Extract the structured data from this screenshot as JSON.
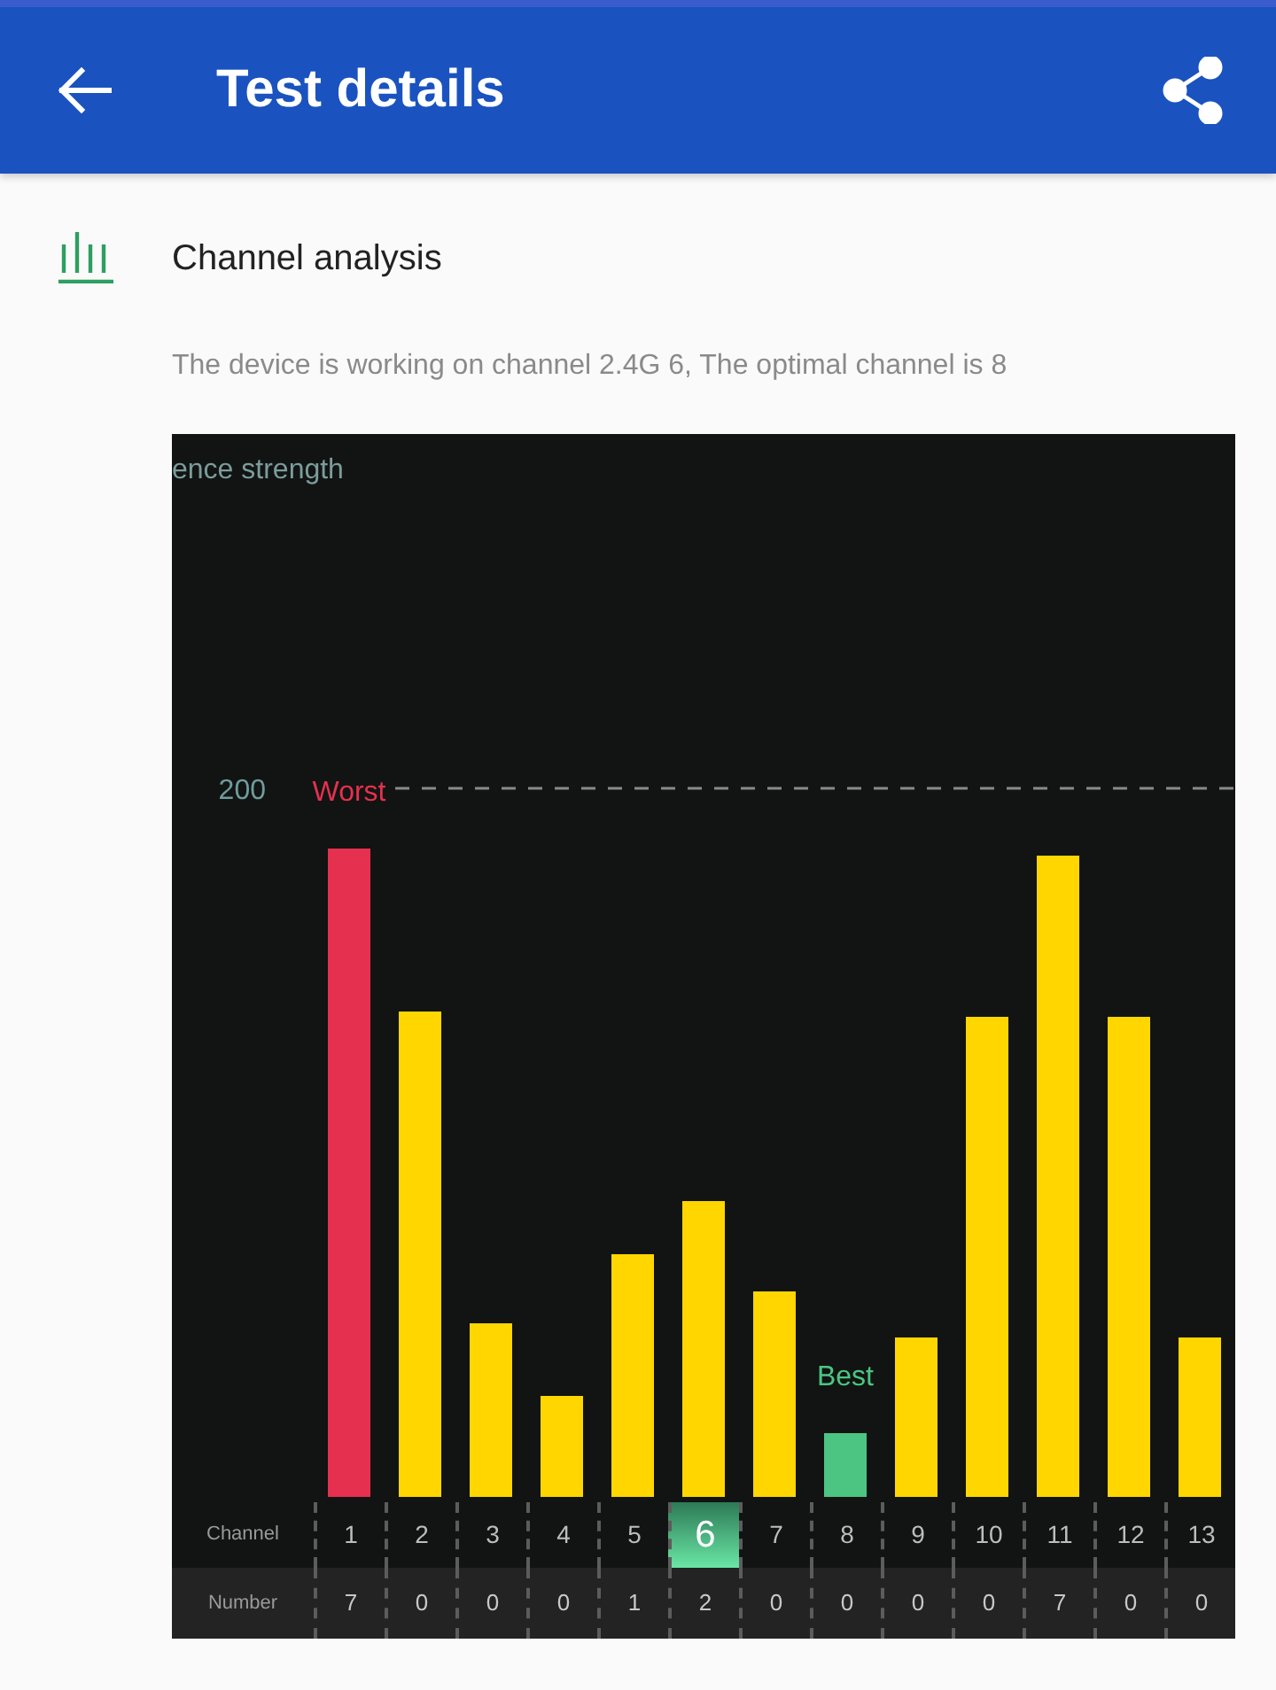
{
  "app_bar": {
    "title": "Test details"
  },
  "section": {
    "title": "Channel analysis",
    "description": "The device is working on channel 2.4G 6, The optimal channel is 8",
    "chart": {
      "caption": "ence strength",
      "line_label": "200",
      "bar_labels": [
        {
          "text": "Worst",
          "color": "#e5304f"
        },
        {
          "text": "Best",
          "color": "#4cc583"
        }
      ]
    },
    "channel_table": {
      "channel_label": "Channel",
      "channels": [
        {
          "text": "1",
          "selected": false
        },
        {
          "text": "2",
          "selected": false
        },
        {
          "text": "3",
          "selected": false
        },
        {
          "text": "4",
          "selected": false
        },
        {
          "text": "5",
          "selected": false
        },
        {
          "text": "6",
          "selected": true
        },
        {
          "text": "7",
          "selected": false
        },
        {
          "text": "8",
          "selected": false
        },
        {
          "text": "9",
          "selected": false
        },
        {
          "text": "10",
          "selected": false
        },
        {
          "text": "11",
          "selected": false
        },
        {
          "text": "12",
          "selected": false
        },
        {
          "text": "13",
          "selected": false
        }
      ],
      "count_label": "Number",
      "counts": [
        "7",
        "0",
        "0",
        "0",
        "1",
        "2",
        "0",
        "0",
        "0",
        "0",
        "7",
        "0",
        "0"
      ]
    }
  }
}
